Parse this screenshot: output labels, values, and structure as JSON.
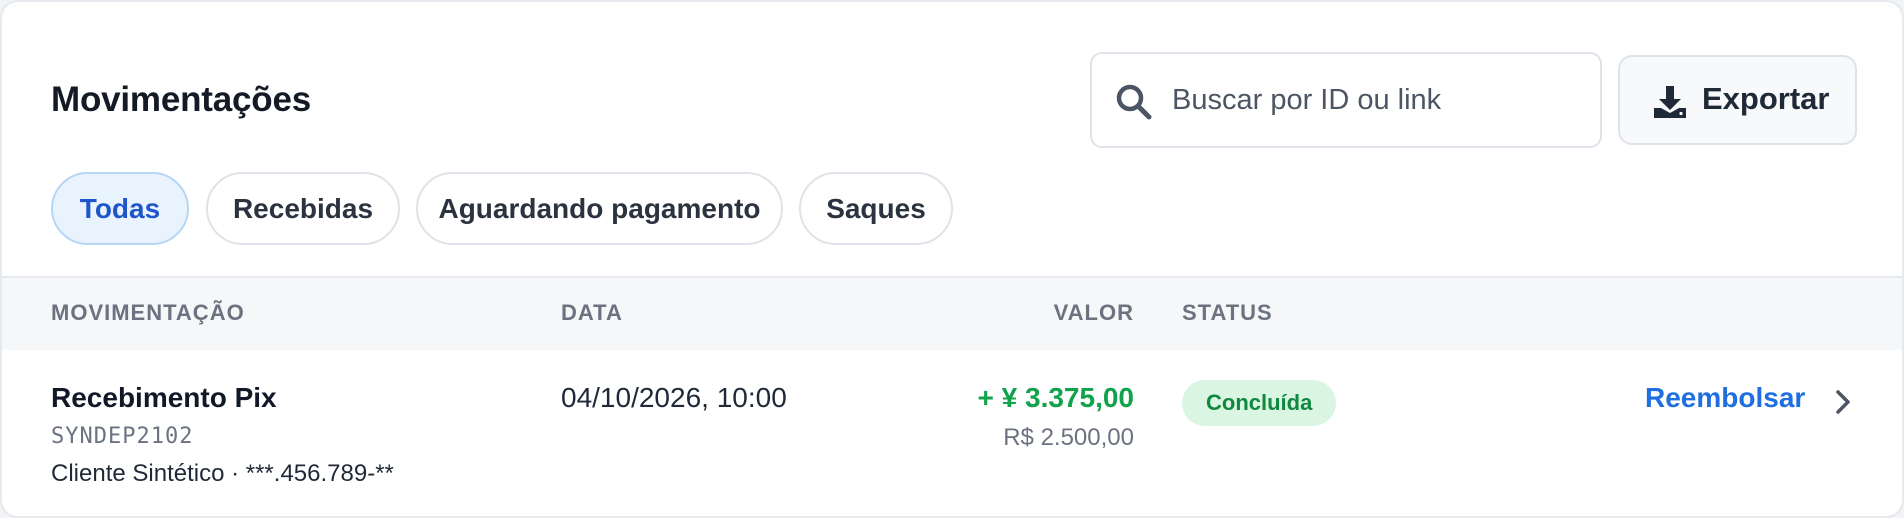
{
  "header": {
    "title": "Movimentações"
  },
  "search": {
    "placeholder": "Buscar por ID ou link",
    "value": "",
    "icon": "search-icon"
  },
  "toolbar": {
    "export_label": "Exportar",
    "export_icon": "download-icon"
  },
  "tabs": [
    {
      "label": "Todas",
      "active": true
    },
    {
      "label": "Recebidas",
      "active": false
    },
    {
      "label": "Aguardando pagamento",
      "active": false
    },
    {
      "label": "Saques",
      "active": false
    }
  ],
  "table": {
    "columns": [
      "MOVIMENTAÇÃO",
      "DATA",
      "VALOR",
      "STATUS"
    ],
    "rows": [
      {
        "title": "Recebimento Pix",
        "id": "SYNDEP2102",
        "client": "Cliente Sintético · ***.456.789-**",
        "date": "04/10/2026, 10:00",
        "amount": "+ ¥ 3.375,00",
        "amount_brl": "R$ 2.500,00",
        "status": "Concluída",
        "action": "Reembolsar",
        "action_icon": "chevron-right-icon"
      }
    ]
  },
  "colors": {
    "accent": "#1f6fe0",
    "active_tab_bg": "#e9f3fd",
    "active_tab_text": "#1e55c8",
    "positive": "#10a34b",
    "status_bg": "#daf6e3",
    "status_text": "#11883f"
  }
}
